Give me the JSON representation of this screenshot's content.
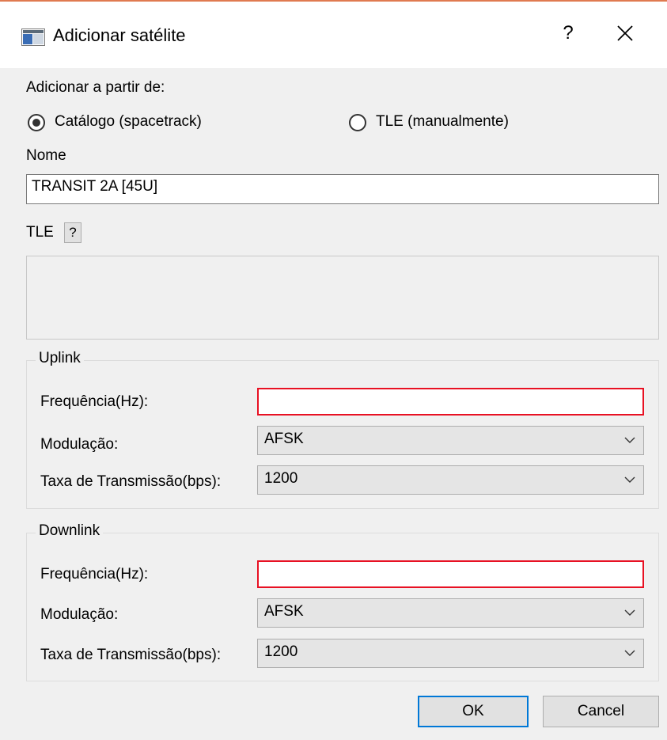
{
  "window": {
    "title": "Adicionar satélite",
    "help_label": "?"
  },
  "source": {
    "label": "Adicionar a partir de:",
    "options": [
      {
        "label": "Catálogo (spacetrack)",
        "selected": true
      },
      {
        "label": "TLE (manualmente)",
        "selected": false
      }
    ]
  },
  "name": {
    "label": "Nome",
    "value": "TRANSIT 2A [45U]"
  },
  "tle": {
    "label": "TLE",
    "help_label": "?",
    "value": ""
  },
  "uplink": {
    "title": "Uplink",
    "frequency_label": "Frequência(Hz):",
    "frequency_value": "",
    "modulation_label": "Modulação:",
    "modulation_value": "AFSK",
    "baud_label": "Taxa de Transmissão(bps):",
    "baud_value": "1200"
  },
  "downlink": {
    "title": "Downlink",
    "frequency_label": "Frequência(Hz):",
    "frequency_value": "",
    "modulation_label": "Modulação:",
    "modulation_value": "AFSK",
    "baud_label": "Taxa de Transmissão(bps):",
    "baud_value": "1200"
  },
  "buttons": {
    "ok": "OK",
    "cancel": "Cancel"
  },
  "colors": {
    "invalid_border": "#e81123",
    "default_button_border": "#0078d7"
  }
}
